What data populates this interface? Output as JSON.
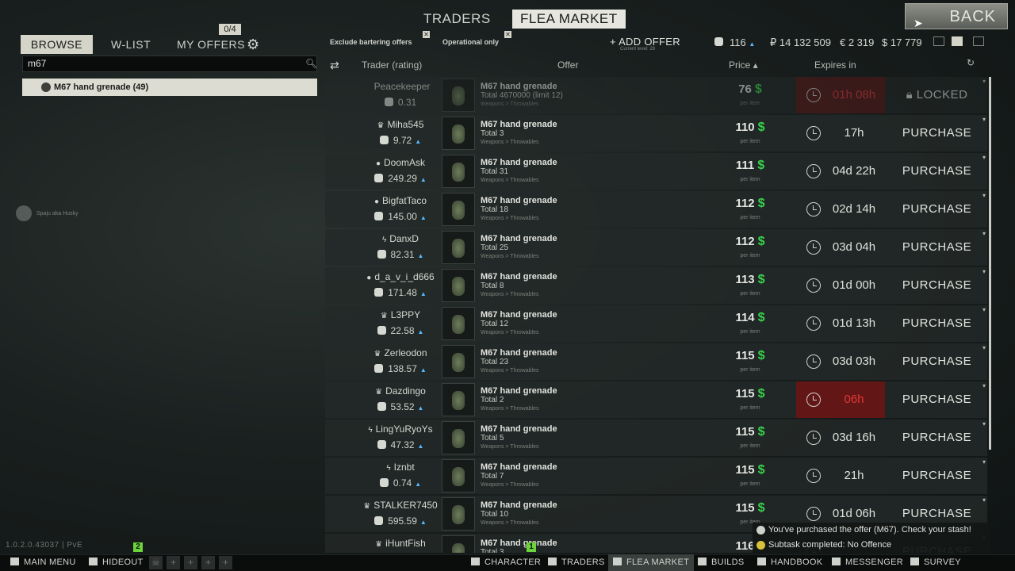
{
  "top_tabs": {
    "traders": "TRADERS",
    "flea_market": "FLEA MARKET",
    "back": "BACK"
  },
  "left": {
    "tabs": {
      "browse": "BROWSE",
      "wlist": "W-LIST",
      "my_offers": "MY OFFERS"
    },
    "offers_count": "0/4",
    "search_value": "m67",
    "result": "M67 hand grenade (49)",
    "friend": "Spaju aka Husky",
    "version": "1.0.2.0.43037 | PvE"
  },
  "filters": {
    "exclude_barter": "Exclude bartering offers",
    "operational_only": "Operational only",
    "add_offer": "+ ADD OFFER",
    "add_offer_sub": "Current level: 28"
  },
  "currency": {
    "gp": "116",
    "rub": "₽ 14 132 509",
    "eur": "€ 2 319",
    "usd": "$ 17 779"
  },
  "columns": {
    "trader": "Trader (rating)",
    "offer": "Offer",
    "price": "Price ▴",
    "expires": "Expires in"
  },
  "per_item": "per item",
  "offers": [
    {
      "trader": "Peacekeeper",
      "rank": "",
      "rating": "0.31",
      "name": "M67 hand grenade",
      "total": "Total 4670000 (limit 12)",
      "category": "Weapons > Throwables",
      "price": "76",
      "expires": "01h 08h",
      "expire_warning": true,
      "action": "LOCKED",
      "locked": true
    },
    {
      "trader": "Miha545",
      "rank": "♛",
      "rating": "9.72",
      "name": "M67 hand grenade",
      "total": "Total 3",
      "category": "Weapons > Throwables",
      "price": "110",
      "expires": "17h",
      "expire_warning": false,
      "action": "PURCHASE",
      "locked": false
    },
    {
      "trader": "DoomAsk",
      "rank": "●",
      "rating": "249.29",
      "name": "M67 hand grenade",
      "total": "Total 31",
      "category": "Weapons > Throwables",
      "price": "111",
      "expires": "04d 22h",
      "expire_warning": false,
      "action": "PURCHASE",
      "locked": false
    },
    {
      "trader": "BigfatTaco",
      "rank": "●",
      "rating": "145.00",
      "name": "M67 hand grenade",
      "total": "Total 18",
      "category": "Weapons > Throwables",
      "price": "112",
      "expires": "02d 14h",
      "expire_warning": false,
      "action": "PURCHASE",
      "locked": false
    },
    {
      "trader": "DanxD",
      "rank": "ϟ",
      "rating": "82.31",
      "name": "M67 hand grenade",
      "total": "Total 25",
      "category": "Weapons > Throwables",
      "price": "112",
      "expires": "03d 04h",
      "expire_warning": false,
      "action": "PURCHASE",
      "locked": false
    },
    {
      "trader": "d_a_v_i_d666",
      "rank": "●",
      "rating": "171.48",
      "name": "M67 hand grenade",
      "total": "Total 8",
      "category": "Weapons > Throwables",
      "price": "113",
      "expires": "01d 00h",
      "expire_warning": false,
      "action": "PURCHASE",
      "locked": false
    },
    {
      "trader": "L3PPY",
      "rank": "♛",
      "rating": "22.58",
      "name": "M67 hand grenade",
      "total": "Total 12",
      "category": "Weapons > Throwables",
      "price": "114",
      "expires": "01d 13h",
      "expire_warning": false,
      "action": "PURCHASE",
      "locked": false
    },
    {
      "trader": "Zerleodon",
      "rank": "♛",
      "rating": "138.57",
      "name": "M67 hand grenade",
      "total": "Total 23",
      "category": "Weapons > Throwables",
      "price": "115",
      "expires": "03d 03h",
      "expire_warning": false,
      "action": "PURCHASE",
      "locked": false
    },
    {
      "trader": "Dazdingo",
      "rank": "♛",
      "rating": "53.52",
      "name": "M67 hand grenade",
      "total": "Total 2",
      "category": "Weapons > Throwables",
      "price": "115",
      "expires": "06h",
      "expire_warning": true,
      "action": "PURCHASE",
      "locked": false
    },
    {
      "trader": "LingYuRyoYs",
      "rank": "ϟ",
      "rating": "47.32",
      "name": "M67 hand grenade",
      "total": "Total 5",
      "category": "Weapons > Throwables",
      "price": "115",
      "expires": "03d 16h",
      "expire_warning": false,
      "action": "PURCHASE",
      "locked": false
    },
    {
      "trader": "Iznbt",
      "rank": "ϟ",
      "rating": "0.74",
      "name": "M67 hand grenade",
      "total": "Total 7",
      "category": "Weapons > Throwables",
      "price": "115",
      "expires": "21h",
      "expire_warning": false,
      "action": "PURCHASE",
      "locked": false
    },
    {
      "trader": "STALKER7450",
      "rank": "♛",
      "rating": "595.59",
      "name": "M67 hand grenade",
      "total": "Total 10",
      "category": "Weapons > Throwables",
      "price": "115",
      "expires": "01d 06h",
      "expire_warning": false,
      "action": "PURCHASE",
      "locked": false
    },
    {
      "trader": "iHuntFish",
      "rank": "♛",
      "rating": "",
      "name": "M67 hand grenade",
      "total": "Total 3",
      "category": "Weapons > Throwables",
      "price": "116",
      "expires": "",
      "expire_warning": false,
      "action": "PURCHASE",
      "locked": false
    }
  ],
  "notifications": [
    "You've purchased the offer (M67). Check your stash!",
    "Subtask completed: No Offence"
  ],
  "bottom": {
    "main_menu": "MAIN MENU",
    "hideout": "HIDEOUT",
    "character": "CHARACTER",
    "traders": "TRADERS",
    "flea_market": "FLEA MARKET",
    "builds": "BUILDS",
    "handbook": "HANDBOOK",
    "messenger": "MESSENGER",
    "survey": "SURVEY",
    "badge_hideout": "2",
    "badge_center": "1"
  },
  "colors": {
    "usd": "#38d24c",
    "expire_warning": "#e0383a",
    "rating_up": "#58b8ff"
  }
}
